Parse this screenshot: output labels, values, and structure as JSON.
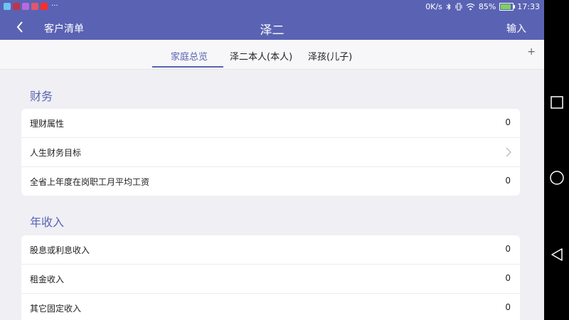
{
  "status_bar": {
    "app_icons": [
      {
        "name": "app-icon-1",
        "color": "#6ec3f2"
      },
      {
        "name": "app-icon-2",
        "color": "#c0344a"
      },
      {
        "name": "app-icon-3",
        "color": "#b76adf"
      },
      {
        "name": "app-icon-4",
        "color": "#e2566d"
      },
      {
        "name": "app-icon-5",
        "color": "#ff2d2d"
      }
    ],
    "more": "···",
    "speed": "0K/s",
    "battery": "85%",
    "battery_level": 0.85,
    "time": "17:33"
  },
  "header": {
    "back_label": "客户清单",
    "title": "泽二",
    "input_button": "输入"
  },
  "tabs": [
    {
      "label": "家庭总览",
      "active": true
    },
    {
      "label": "泽二本人(本人)",
      "active": false
    },
    {
      "label": "泽孩(儿子)",
      "active": false
    }
  ],
  "tab_add": "+",
  "sections": [
    {
      "title": "财务",
      "rows": [
        {
          "label": "理财属性",
          "value": "0"
        },
        {
          "label": "人生财务目标",
          "value": "",
          "chevron": true
        },
        {
          "label": "全省上年度在岗职工月平均工资",
          "value": "0"
        }
      ]
    },
    {
      "title": "年收入",
      "rows": [
        {
          "label": "股息或利息收入",
          "value": "0"
        },
        {
          "label": "租金收入",
          "value": "0"
        },
        {
          "label": "其它固定收入",
          "value": "0"
        }
      ]
    }
  ],
  "colors": {
    "accent": "#5a63b3",
    "background": "#efeff4"
  }
}
